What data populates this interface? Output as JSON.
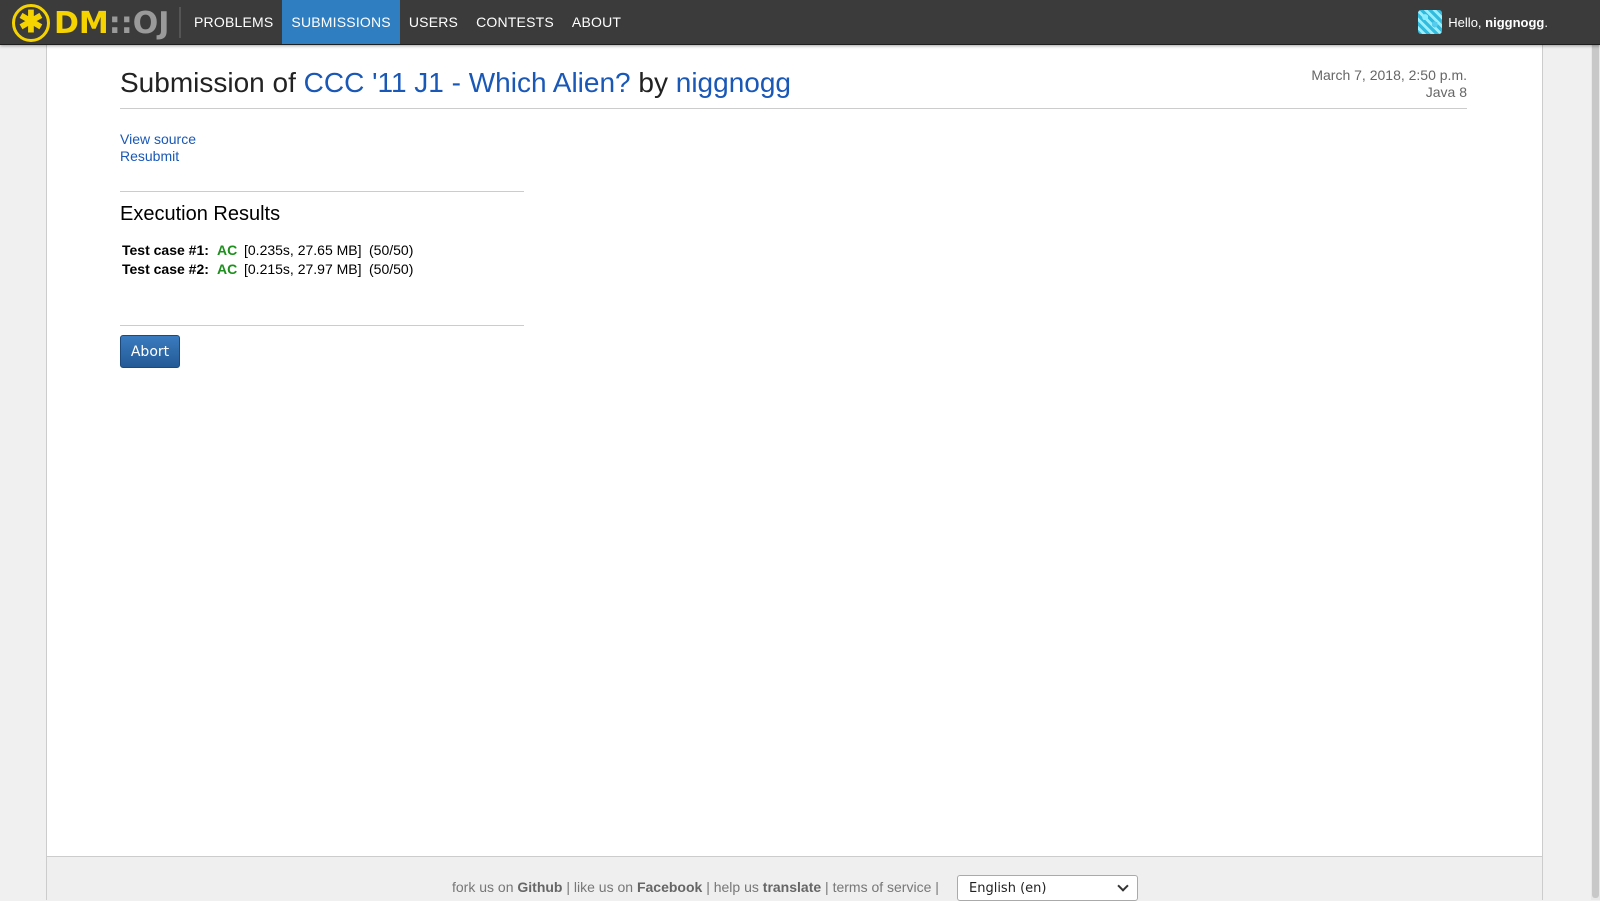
{
  "navbar": {
    "logo": {
      "dm": "DM",
      "sep": "::",
      "oj": "OJ",
      "mark": "✱"
    },
    "menu": [
      {
        "label": "PROBLEMS"
      },
      {
        "label": "SUBMISSIONS",
        "active": true
      },
      {
        "label": "USERS"
      },
      {
        "label": "CONTESTS"
      },
      {
        "label": "ABOUT"
      }
    ],
    "user": {
      "greeting": "Hello,",
      "username": "niggnogg",
      "suffix": "."
    }
  },
  "submission": {
    "title_prefix": "Submission of",
    "problem": "CCC '11 J1 - Which Alien?",
    "by": "by",
    "user": "niggnogg",
    "date": "March 7, 2018, 2:50 p.m.",
    "language": "Java 8"
  },
  "links": {
    "view_source": "View source",
    "resubmit": "Resubmit"
  },
  "execution": {
    "title": "Execution Results",
    "cases": [
      {
        "label": "Test case #1:",
        "status": "AC",
        "resources": "[0.235s, 27.65 MB]",
        "points": "(50/50)"
      },
      {
        "label": "Test case #2:",
        "status": "AC",
        "resources": "[0.215s, 27.97 MB]",
        "points": "(50/50)"
      }
    ]
  },
  "abort_label": "Abort",
  "footer": {
    "fork": "fork us on",
    "github": "Github",
    "like": "like us on",
    "facebook": "Facebook",
    "help": "help us",
    "translate": "translate",
    "tos": "terms of service",
    "pipe": "|",
    "language_select": "English (en)"
  },
  "colors": {
    "navbar_bg": "#3b3b3b",
    "active_tab": "#2f7ec1",
    "link": "#1958b7",
    "ac_green": "#1c8f1c",
    "logo_yellow": "#f5d300"
  },
  "icons": [
    "logo-asterisk-icon",
    "avatar-icon",
    "chevron-down-icon"
  ]
}
